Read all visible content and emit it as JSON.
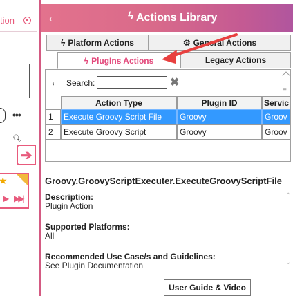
{
  "left_panel": {
    "top_text": "tion"
  },
  "header": {
    "title": "Actions Library"
  },
  "tabs": {
    "platform": "Platform Actions",
    "general": "General Actions",
    "plugins": "PlugIns Actions",
    "legacy": "Legacy Actions"
  },
  "search": {
    "label": "Search:",
    "value": ""
  },
  "grid": {
    "columns": [
      "Action Type",
      "Plugin ID",
      "Servic"
    ],
    "rows": [
      {
        "num": "1",
        "action_type": "Execute Groovy Script File",
        "plugin_id": "Groovy",
        "service": "Groov"
      },
      {
        "num": "2",
        "action_type": "Execute Groovy Script",
        "plugin_id": "Groovy",
        "service": "Groov"
      }
    ]
  },
  "details": {
    "name": "Groovy.GroovyScriptExecuter.ExecuteGroovyScriptFile",
    "description_label": "Description:",
    "description_value": "Plugin Action",
    "platforms_label": "Supported Platforms:",
    "platforms_value": "All",
    "usecase_label": "Recommended Use Case/s and Guidelines:",
    "usecase_value": "See Plugin Documentation",
    "guide_button": "User Guide & Video"
  },
  "colors": {
    "accent": "#e34a7c",
    "selection": "#3399ff",
    "header_start": "#e3728d",
    "header_end": "#b0569e"
  }
}
